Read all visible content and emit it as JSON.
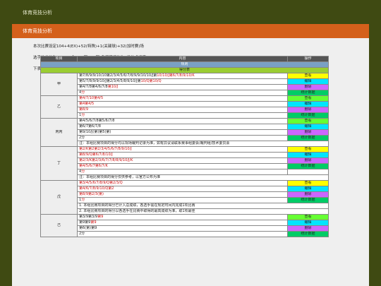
{
  "top_title": "体育竞技分析",
  "card": {
    "title": "体育竞技分析"
  },
  "descriptions": [
    {
      "parts": [
        {
          "t": "本次比赛设定104+4(EX)+52(特殊)+1(关键球)+32(加时赛)场",
          "red": false
        }
      ]
    },
    {
      "parts": [
        {
          "t": "选手的总分为108+1(金)+1(银)52(铜)各奖项细化为4级技术评定",
          "red": false
        }
      ]
    },
    {
      "parts": [
        {
          "t": "下表列出",
          "red": false
        },
        {
          "t": "部分",
          "red": true
        },
        {
          "t": "比赛项目的得分统计以及相关选手的排名，仅供参考",
          "red": false
        }
      ]
    }
  ],
  "table": {
    "headers": [
      "项目",
      "内容",
      "操作"
    ],
    "section": "规则",
    "subsection": "得分表",
    "groups": [
      {
        "name": "甲",
        "rows": [
          {
            "parts": [
              {
                "t": "第7/8/9/9/10/10第2/3/4/5/6/7/8/9/9/10/10/J第",
                "red": false
              },
              {
                "t": "10/10/J第6/7/8/9/10/K",
                "red": true
              }
            ],
            "action": "查看",
            "color": "#ffff00"
          },
          {
            "parts": [
              {
                "t": "第5/7/8/9/9/10/J第2/3/4/5/8/9/10/J第",
                "red": false
              },
              {
                "t": "10/Q第10/Q",
                "red": true
              }
            ],
            "action": "编辑",
            "color": "#00e5ff"
          },
          {
            "parts": [
              {
                "t": "第4/7/8第4/6/7/8",
                "red": false
              },
              {
                "t": "第10/J",
                "red": true
              }
            ],
            "action": "删除",
            "color": "#cc66ff"
          },
          {
            "parts": [
              {
                "t": "4",
                "red": false
              },
              {
                "t": "分",
                "red": true
              }
            ],
            "action": "统计数据",
            "color": "#00cc66"
          }
        ]
      },
      {
        "name": "乙",
        "rows": [
          {
            "parts": [
              {
                "t": "第4/7/10第4/5",
                "red": true
              }
            ],
            "action": "查看",
            "color": "#66ff33"
          },
          {
            "parts": [
              {
                "t": "第4第4/5",
                "red": true
              }
            ],
            "action": "编辑",
            "color": "#00e5ff"
          },
          {
            "parts": [
              {
                "t": "第8/9",
                "red": true
              }
            ],
            "action": "删除",
            "color": "#cc66ff"
          },
          {
            "parts": [
              {
                "t": "1",
                "red": false
              },
              {
                "t": "分",
                "red": true
              }
            ],
            "action": "统计数据",
            "color": "#00cc66"
          }
        ]
      },
      {
        "name": "丙丙",
        "rows": [
          {
            "parts": [
              {
                "t": "第4/5/6/7/8第5/6/7/8",
                "red": false
              }
            ],
            "action": "查看",
            "color": "#66ff33"
          },
          {
            "parts": [
              {
                "t": "第6/7第6/7/8",
                "red": false
              }
            ],
            "action": "编辑",
            "color": "#00e5ff"
          },
          {
            "parts": [
              {
                "t": "第9/10/J(第)第5(第)",
                "red": false
              }
            ],
            "action": "删除",
            "color": "#cc66ff"
          },
          {
            "parts": [
              {
                "t": "2分",
                "red": false
              }
            ],
            "action": "统计数据",
            "color": "#00cc66"
          }
        ],
        "note": "注：本组比赛项目的得分均以现场裁判记录为准，如有异议请联系赛事组委会/裁判组/技术委员会"
      },
      {
        "name": "丁",
        "rows": [
          {
            "parts": [
              {
                "t": "第2/K第2第2/3/4/5/6/7/8/9/10/J",
                "red": true
              }
            ],
            "action": "查看",
            "color": "#ffff00"
          },
          {
            "parts": [
              {
                "t": "第8/9/Q第6/7/8/10/J",
                "red": true
              }
            ],
            "action": "编辑",
            "color": "#00e5ff"
          },
          {
            "parts": [
              {
                "t": "第2/3/K第2/3/6/7/7/8/8/9/10/J/K",
                "red": true
              }
            ],
            "action": "删除",
            "color": "#cc66ff"
          },
          {
            "parts": [
              {
                "t": "第4/5/6/7第6/7/K",
                "red": true
              }
            ],
            "action": "统计数据",
            "color": "#00cc66"
          },
          {
            "parts": [
              {
                "t": "4",
                "red": false
              },
              {
                "t": "分",
                "red": true
              }
            ],
            "action": "",
            "color": ""
          }
        ],
        "note": "注：本组比赛项目的得分仅供参考，以官方公布为准"
      },
      {
        "name": "戊",
        "rows": [
          {
            "parts": [
              {
                "t": "第3/4/5/6/7/8/9/Q第2/3/Q",
                "red": true
              }
            ],
            "action": "查看",
            "color": "#ffff00"
          },
          {
            "parts": [
              {
                "t": "第4/6/7/8/9/10/Q第2",
                "red": true
              }
            ],
            "action": "编辑",
            "color": "#00e5ff"
          },
          {
            "parts": [
              {
                "t": "第8/9第2/3(第)",
                "red": true
              }
            ],
            "action": "删除",
            "color": "#cc66ff"
          },
          {
            "parts": [
              {
                "t": "1",
                "red": false
              },
              {
                "t": "分",
                "red": true
              }
            ],
            "action": "统计数据",
            "color": "#00cc66"
          }
        ],
        "notes": [
          "1. 本组比赛项目的得分已计入总成绩，各选手需在规定时间内完成1项比赛",
          "2. 本组比赛项目的得分以各选手在比赛中取得的最高成绩为准，取1项最佳"
        ]
      },
      {
        "name": "己",
        "rows": [
          {
            "parts": [
              {
                "t": "第3/9第3/9",
                "red": false
              },
              {
                "t": "第9",
                "red": true
              }
            ],
            "action": "查看",
            "color": "#66ff33"
          },
          {
            "parts": [
              {
                "t": "第9第9",
                "red": false
              },
              {
                "t": "第9",
                "red": true
              }
            ],
            "action": "编辑",
            "color": "#00e5ff"
          },
          {
            "parts": [
              {
                "t": "第6(第)第9",
                "red": false
              }
            ],
            "action": "删除",
            "color": "#cc66ff"
          },
          {
            "parts": [
              {
                "t": "2分",
                "red": false
              }
            ],
            "action": "统计数据",
            "color": "#00cc66"
          }
        ]
      }
    ]
  }
}
